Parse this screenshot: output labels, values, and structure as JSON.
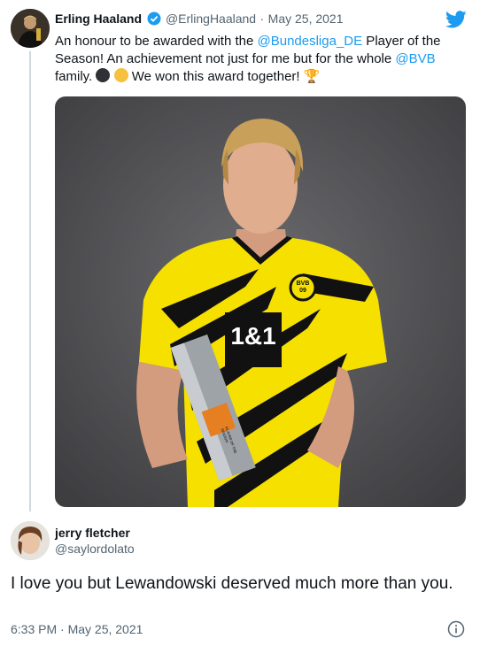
{
  "tweet": {
    "author_name": "Erling Haaland",
    "handle": "@ErlingHaaland",
    "separator": "·",
    "date": "May 25, 2021",
    "text_part1": "An honour to be awarded with the ",
    "mention1": "@Bundesliga_DE",
    "text_part2": " Player of the Season! An achievement not just for me but for the whole ",
    "mention2": "@BVB",
    "text_part3": " family. ",
    "text_part4": " We won this award together! ",
    "trophy": "🏆"
  },
  "media": {
    "shirt_sponsor": "1&1",
    "crest_text": "BVB",
    "crest_year": "09",
    "trophy_text": "PLAYER OF THE SEASON"
  },
  "reply": {
    "author_name": "jerry fletcher",
    "handle": "@saylordolato",
    "text": "I love you but Lewandowski deserved much more than you.",
    "time": "6:33 PM · May 25, 2021"
  },
  "colors": {
    "accent": "#1d9bf0",
    "bvb_yellow": "#f6e000",
    "bvb_black": "#111111"
  },
  "icons": [
    "verified-icon",
    "twitter-bird-icon",
    "info-icon",
    "black-circle-emoji",
    "yellow-circle-emoji",
    "trophy-emoji"
  ]
}
